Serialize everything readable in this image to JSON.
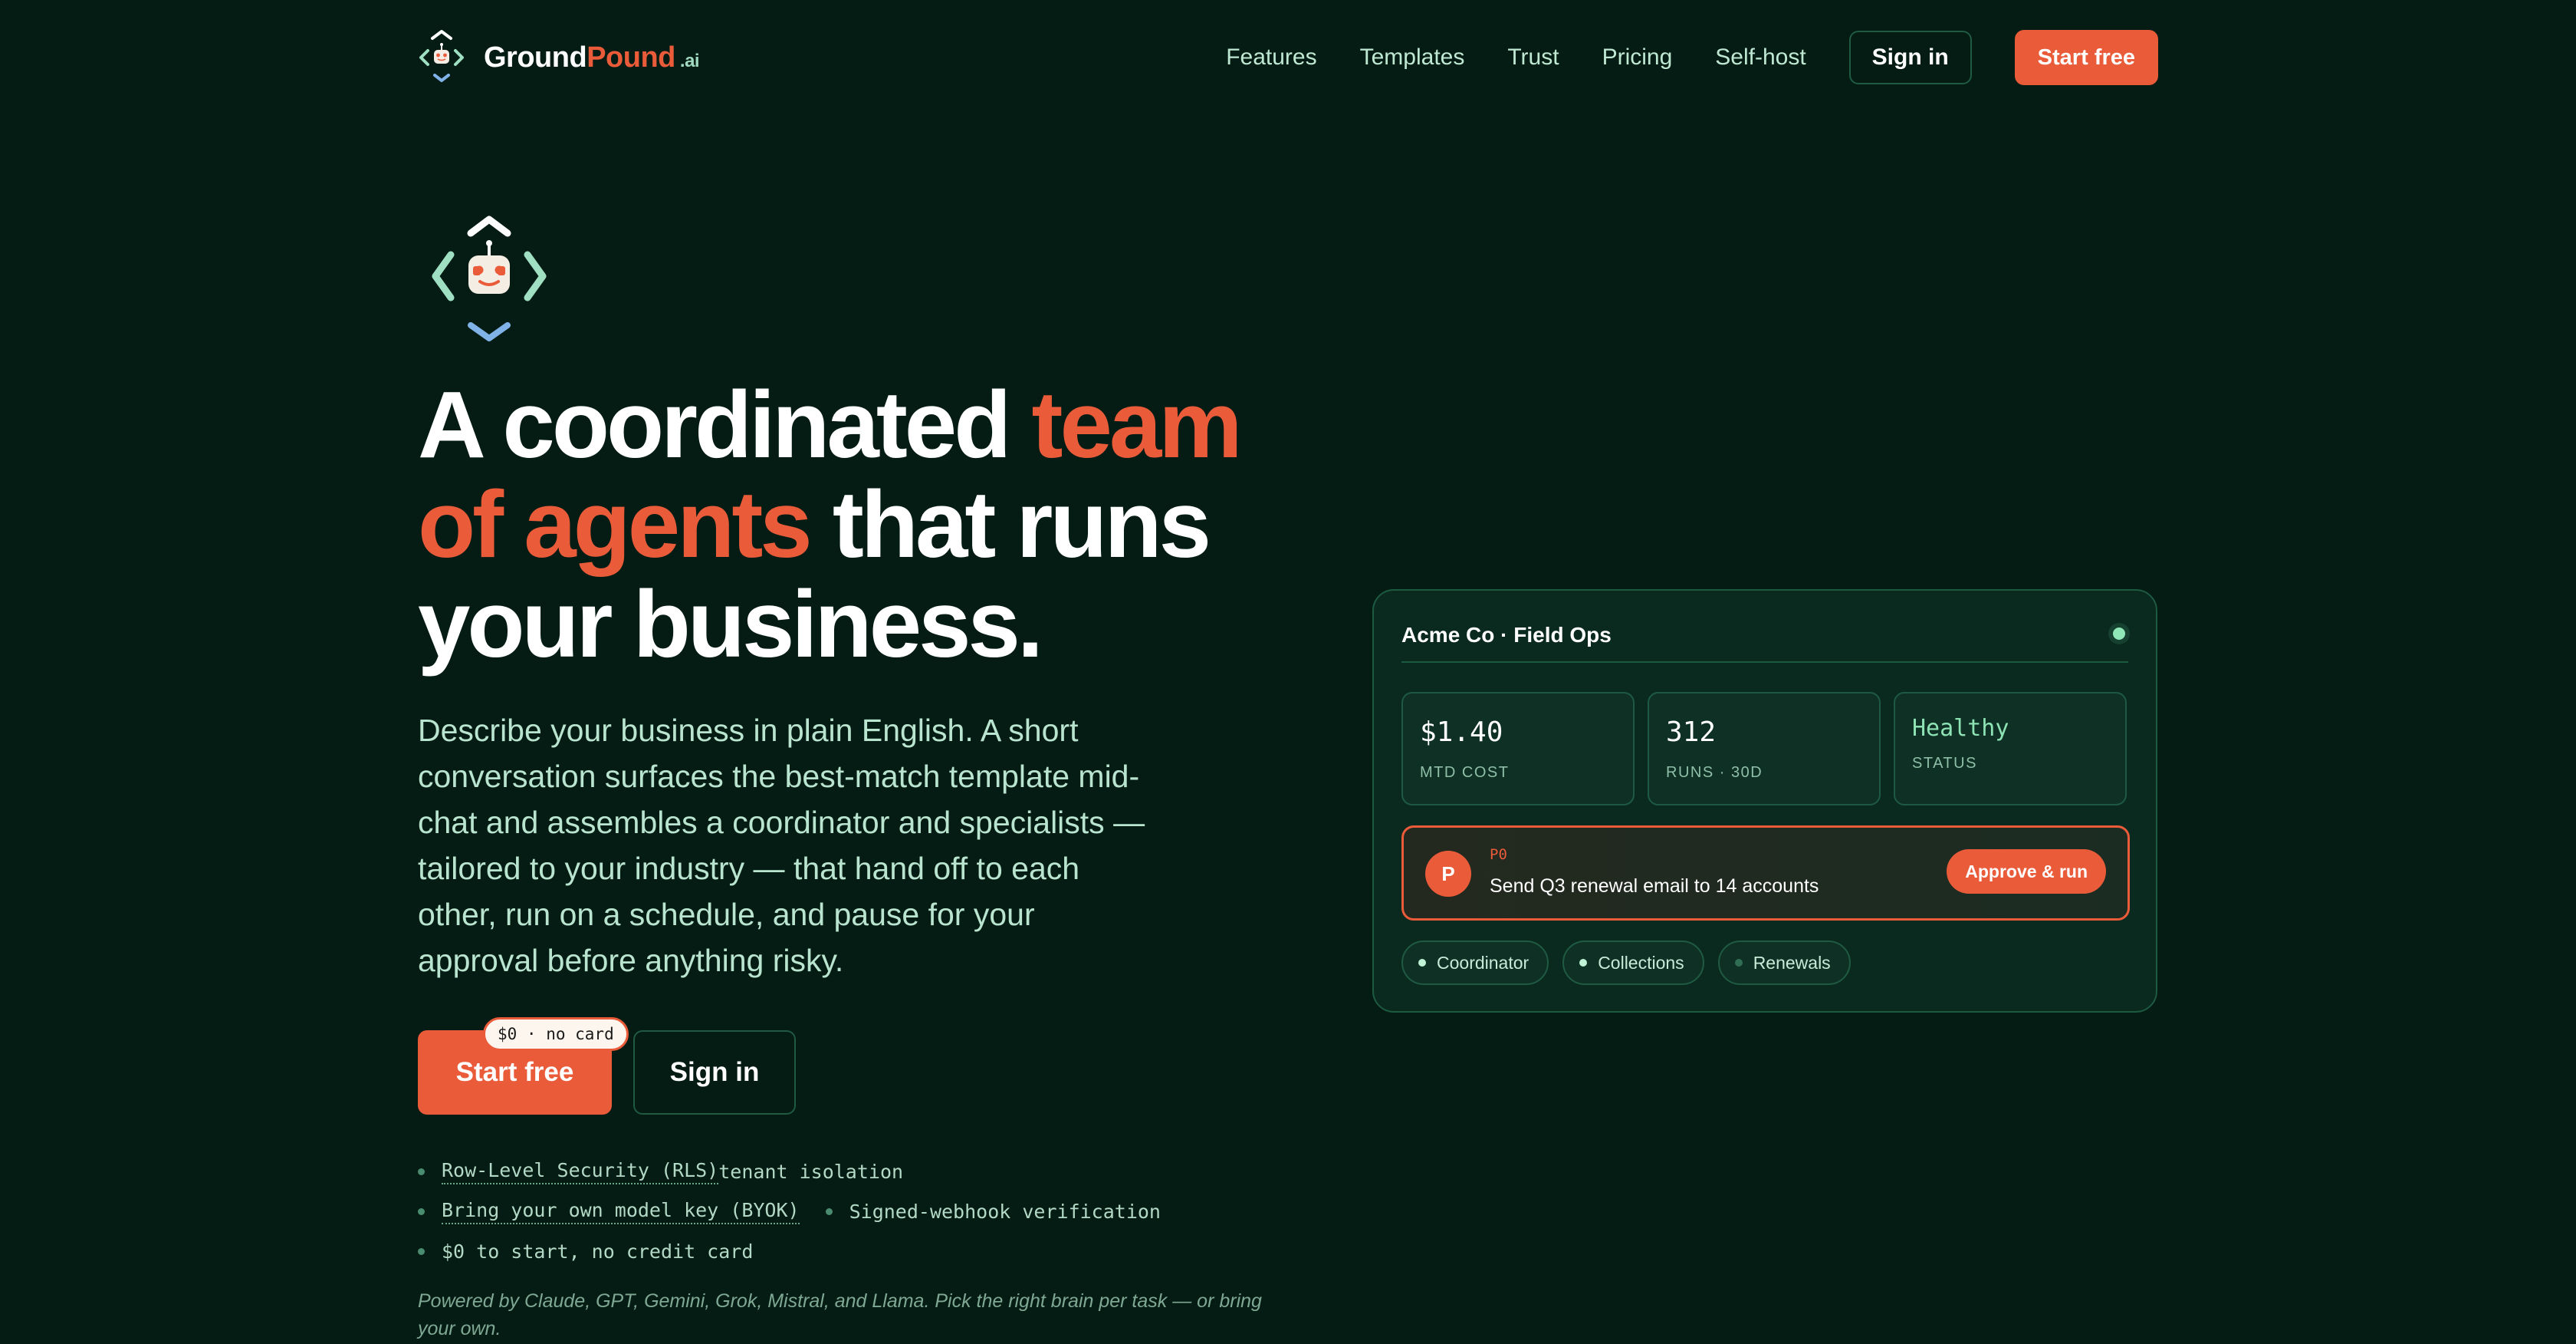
{
  "brand": {
    "name_primary": "Ground",
    "name_accent": "Pound",
    "suffix": ".ai"
  },
  "nav": {
    "links": [
      "Features",
      "Templates",
      "Trust",
      "Pricing",
      "Self-host"
    ],
    "sign_in": "Sign in",
    "start_free": "Start free"
  },
  "hero": {
    "headline_1": "A coordinated ",
    "headline_accent": "team of agents",
    "headline_2": " that runs your business.",
    "subtitle": "Describe your business in plain English. A short conversation surfaces the best-match template mid-chat and assembles a coordinator and specialists — tailored to your industry — that hand off to each other, run on a schedule, and pause for your approval before anything risky.",
    "cta_primary": "Start free",
    "cta_badge": "$0 · no card",
    "cta_secondary": "Sign in",
    "trust": {
      "rls": "Row-Level Security (RLS)",
      "rls_tail": " tenant isolation",
      "byok": "Bring your own model key (BYOK)",
      "webhook": "Signed-webhook verification",
      "pricing": "$0 to start, no credit card"
    },
    "powered_by": "Powered by Claude, GPT, Gemini, Grok, Mistral, and Llama. Pick the right brain per task — or bring your own."
  },
  "dashboard": {
    "title": "Acme Co · Field Ops",
    "stats": [
      {
        "value": "$1.40",
        "label": "MTD COST"
      },
      {
        "value": "312",
        "label": "RUNS · 30D"
      },
      {
        "value": "Healthy",
        "label": "STATUS"
      }
    ],
    "approval": {
      "avatar": "P",
      "priority": "P0",
      "task": "Send Q3 renewal email to 14 accounts",
      "action": "Approve & run"
    },
    "agents": [
      "Coordinator",
      "Collections",
      "Renewals"
    ]
  },
  "colors": {
    "background": "#051c14",
    "accent": "#ea5b3a",
    "mint": "#8fe7b8",
    "card": "#0b2a1f"
  },
  "icons": {
    "logo": "robot-in-arrows-icon",
    "status": "online-dot-icon"
  }
}
